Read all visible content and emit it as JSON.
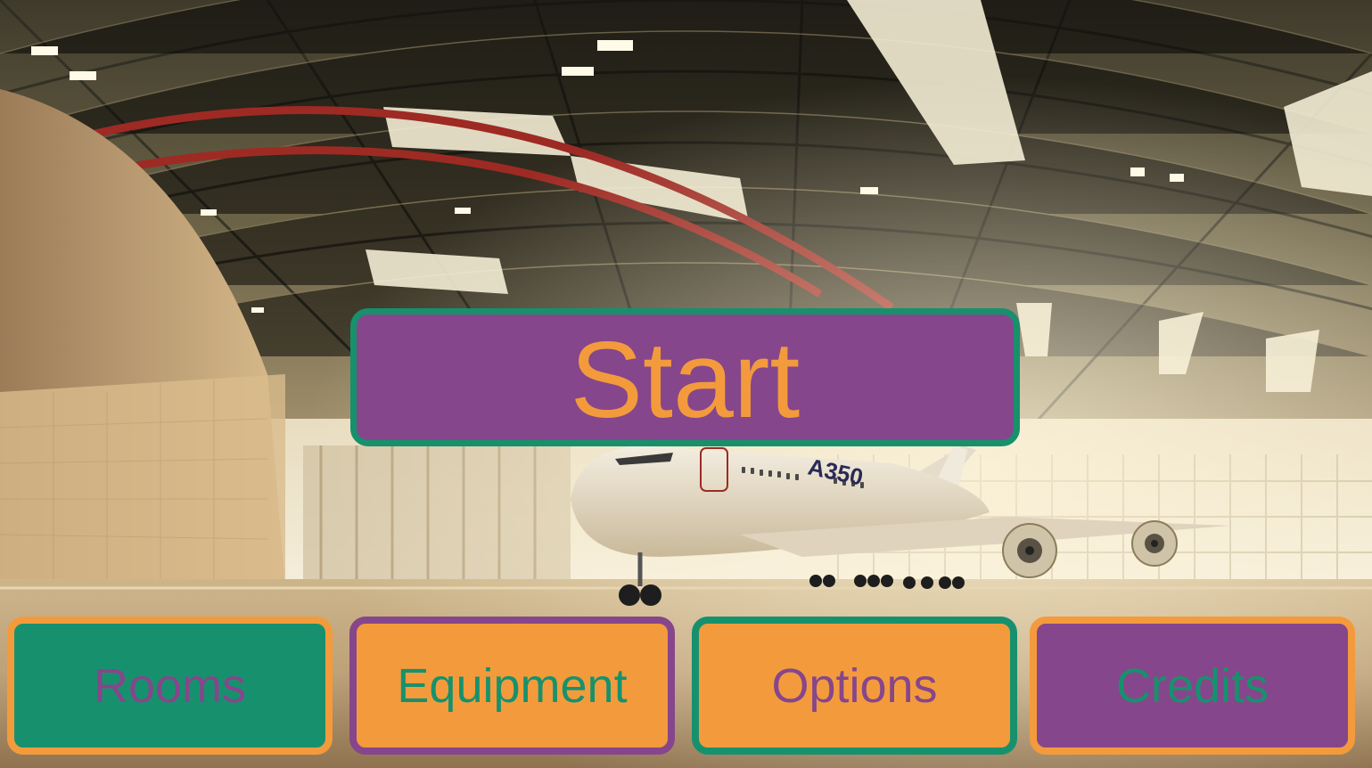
{
  "colors": {
    "purple": "#86468b",
    "orange": "#f39b3c",
    "green": "#17916d"
  },
  "background": {
    "scene": "aircraft-hangar-with-airliner",
    "fuselage_marking": "A350"
  },
  "menu": {
    "start_label": "Start",
    "rooms_label": "Rooms",
    "equipment_label": "Equipment",
    "options_label": "Options",
    "credits_label": "Credits"
  }
}
